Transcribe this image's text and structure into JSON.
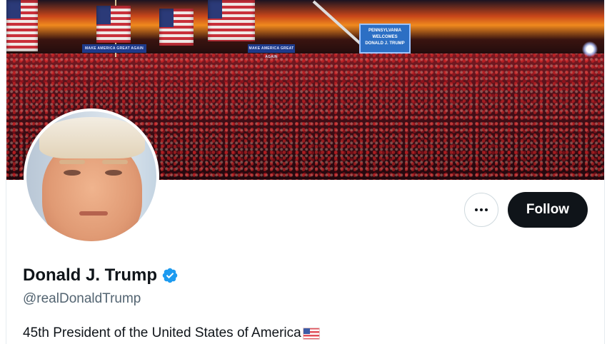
{
  "banner": {
    "sign_left": "MAKE AMERICA GREAT AGAIN",
    "sign_right": "MAKE AMERICA GREAT AGAIN",
    "screen_line1": "PENNSYLVANIA",
    "screen_line2": "WELCOMES",
    "screen_line3": "DONALD J. TRUMP"
  },
  "profile": {
    "display_name": "Donald J. Trump",
    "handle": "@realDonaldTrump",
    "bio": "45th President of the United States of America",
    "bio_emoji": "us-flag-icon",
    "verified": true
  },
  "actions": {
    "more_label": "More",
    "follow_label": "Follow"
  },
  "colors": {
    "follow_bg": "#0f1419",
    "verified": "#1d9bf0",
    "handle_text": "#536471"
  }
}
